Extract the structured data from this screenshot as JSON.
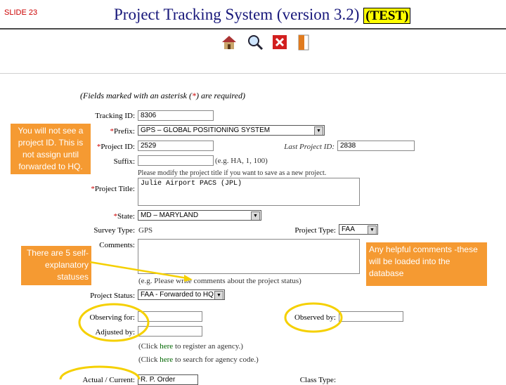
{
  "slide": {
    "tag": "SLIDE 23"
  },
  "header": {
    "title_prefix": "Project Tracking System (version 3.2)",
    "title_test": "(TEST)"
  },
  "toolbar": {
    "icons": [
      "home-icon",
      "search-icon",
      "delete-icon",
      "exit-door-icon"
    ]
  },
  "form": {
    "required_note_pre": "(Fields marked with an asterisk (",
    "required_note_star": "*",
    "required_note_post": ") are required)",
    "tracking_id": {
      "label": "Tracking ID:",
      "value": "8306"
    },
    "prefix": {
      "label": "Prefix:",
      "value": "GPS – GLOBAL POSITIONING SYSTEM"
    },
    "project_id": {
      "label": "Project ID:",
      "value": "2529"
    },
    "last_project_id": {
      "label": "Last Project ID:",
      "value": "2838"
    },
    "suffix": {
      "label": "Suffix:",
      "value": "",
      "hint": "(e.g. HA, 1, 100)"
    },
    "title_note": "Please modify the project title if you want to save as a new project.",
    "project_title": {
      "label": "Project Title:",
      "value": "Julie Airport PACS (JPL)"
    },
    "state": {
      "label": "State:",
      "value": "MD – MARYLAND"
    },
    "survey_type": {
      "label": "Survey Type:",
      "value": "GPS"
    },
    "project_type": {
      "label": "Project Type:",
      "value": "FAA"
    },
    "comments": {
      "label": "Comments:",
      "value": "",
      "hint": "(e.g. Please write comments about the project status)"
    },
    "project_status": {
      "label": "Project Status:",
      "value": "FAA - Forwarded to HQ"
    },
    "observing_for": {
      "label": "Observing for:",
      "value": ""
    },
    "observed_by": {
      "label": "Observed by:",
      "value": ""
    },
    "adjusted_by": {
      "label": "Adjusted by:",
      "value": ""
    },
    "register_note_pre": "(Click ",
    "register_link": "here",
    "register_note_post": " to register an agency.)",
    "search_note_pre": "(Click ",
    "search_link": "here",
    "search_note_post": " to search for agency code.)",
    "bottom_left_label": "Actual / Current:",
    "bottom_left_value": "R. P. Order",
    "bottom_right_label": "Class Type:"
  },
  "callouts": {
    "project_id_note": "You will not see a project ID.  This is not assign until forwarded to HQ.",
    "status_note": "There are 5 self-explanatory statuses",
    "comments_note": "Any helpful comments -these  will be loaded into the database"
  },
  "colors": {
    "title": "#17177a",
    "callout": "#f59a32",
    "highlight_ring": "#f5d000",
    "arrow": "#f5d000",
    "required": "#cc0000"
  }
}
